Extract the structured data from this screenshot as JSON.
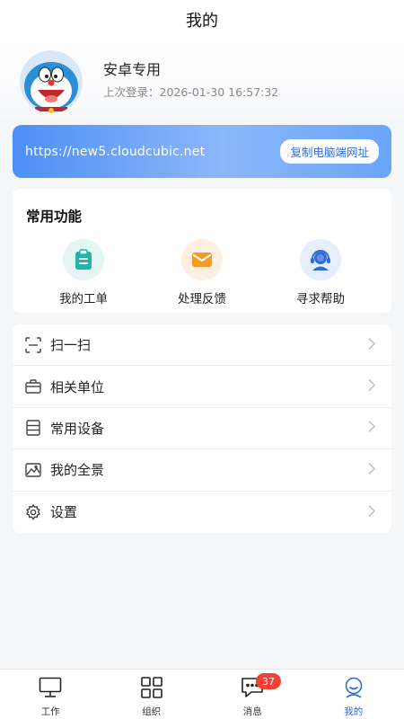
{
  "header": {
    "title": "我的"
  },
  "profile": {
    "name": "安卓专用",
    "last_login": "上次登录：2026-01-30 16:57:32"
  },
  "site": {
    "url": "https://new5.cloudcubic.net",
    "copy_label": "复制电脑端网址"
  },
  "functions": {
    "title": "常用功能",
    "items": [
      {
        "label": "我的工单",
        "icon": "clipboard-icon",
        "color": "#26b3a8"
      },
      {
        "label": "处理反馈",
        "icon": "envelope-icon",
        "color": "#f59a23"
      },
      {
        "label": "寻求帮助",
        "icon": "support-agent-icon",
        "color": "#2f6cd8"
      }
    ]
  },
  "menu": {
    "items": [
      {
        "label": "扫一扫",
        "icon": "scan-icon"
      },
      {
        "label": "相关单位",
        "icon": "briefcase-icon"
      },
      {
        "label": "常用设备",
        "icon": "device-icon"
      },
      {
        "label": "我的全景",
        "icon": "panorama-icon"
      },
      {
        "label": "设置",
        "icon": "gear-icon"
      }
    ]
  },
  "tabbar": {
    "items": [
      {
        "label": "工作",
        "icon": "monitor-icon"
      },
      {
        "label": "组织",
        "icon": "grid-icon"
      },
      {
        "label": "消息",
        "icon": "chat-icon",
        "badge": "37"
      },
      {
        "label": "我的",
        "icon": "user-icon",
        "active": true
      }
    ]
  },
  "colors": {
    "accent": "#2f6cd8",
    "badge": "#f04134"
  }
}
